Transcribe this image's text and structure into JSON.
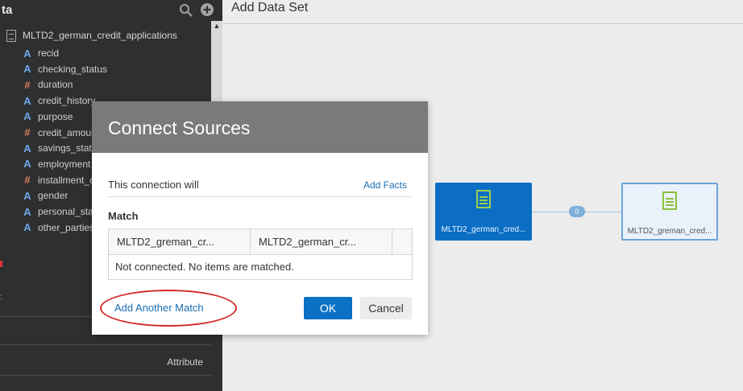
{
  "panel": {
    "title": "ta",
    "dataset": "MLTD2_german_credit_applications",
    "columns": [
      {
        "type": "attr",
        "icon": "A",
        "label": "recid"
      },
      {
        "type": "attr",
        "icon": "A",
        "label": "checking_status"
      },
      {
        "type": "meas",
        "icon": "#",
        "label": "duration"
      },
      {
        "type": "attr",
        "icon": "A",
        "label": "credit_history"
      },
      {
        "type": "attr",
        "icon": "A",
        "label": "purpose"
      },
      {
        "type": "meas",
        "icon": "#",
        "label": "credit_amount"
      },
      {
        "type": "attr",
        "icon": "A",
        "label": "savings_status"
      },
      {
        "type": "attr",
        "icon": "A",
        "label": "employment"
      },
      {
        "type": "meas",
        "icon": "#",
        "label": "installment_commitment"
      },
      {
        "type": "attr",
        "icon": "A",
        "label": "gender"
      },
      {
        "type": "attr",
        "icon": "A",
        "label": "personal_status"
      },
      {
        "type": "attr",
        "icon": "A",
        "label": "other_parties"
      }
    ],
    "attribute_label": "Attribute",
    "colors": {
      "attr": "#6fa8e8",
      "meas": "#e07c5b",
      "background": "#2e2f31"
    }
  },
  "main": {
    "title": "Add Data Set",
    "node_left_label": "MLTD2_german_cred...",
    "node_right_label": "MLTD2_greman_cred...",
    "connector_count": "0",
    "colors": {
      "node_selected": "#0b6ec4",
      "node_unselected": "#e9f2fb"
    }
  },
  "dialog": {
    "title": "Connect Sources",
    "connection_text": "This connection will",
    "add_facts": "Add Facts",
    "match_label": "Match",
    "col1": "MLTD2_greman_cr...",
    "col2": "MLTD2_german_cr...",
    "empty_text": "Not connected. No items are matched.",
    "add_match": "Add Another Match",
    "ok": "OK",
    "cancel": "Cancel",
    "colors": {
      "header": "#7a7a7a",
      "ok_button": "#0a71c4",
      "annotation": "#d42a2a"
    }
  }
}
